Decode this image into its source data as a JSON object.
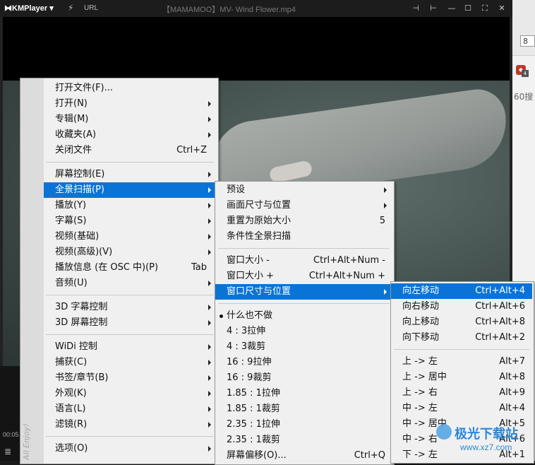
{
  "window": {
    "logo": "⧓KMPlayer ▾",
    "url_label": "URL",
    "title": "【MAMAMOO】MV- Wind Flower.mp4",
    "time": "00:05",
    "side_text": "All Enjoy!"
  },
  "bg_app": {
    "box_text": "8",
    "badge": "4",
    "text": "60搜"
  },
  "menu_main": [
    {
      "label": "打开文件(F)...",
      "shortcut": "",
      "arrow": false
    },
    {
      "label": "打开(N)",
      "shortcut": "",
      "arrow": true
    },
    {
      "label": "专辑(M)",
      "shortcut": "",
      "arrow": true
    },
    {
      "label": "收藏夹(A)",
      "shortcut": "",
      "arrow": true
    },
    {
      "label": "关闭文件",
      "shortcut": "Ctrl+Z",
      "arrow": false
    },
    {
      "label": "屏幕控制(E)",
      "shortcut": "",
      "arrow": true
    },
    {
      "label": "全景扫描(P)",
      "shortcut": "",
      "arrow": true,
      "highlight": true
    },
    {
      "label": "播放(Y)",
      "shortcut": "",
      "arrow": true
    },
    {
      "label": "字幕(S)",
      "shortcut": "",
      "arrow": true
    },
    {
      "label": "视频(基础)",
      "shortcut": "",
      "arrow": true
    },
    {
      "label": "视频(高级)(V)",
      "shortcut": "",
      "arrow": true
    },
    {
      "label": "播放信息 (在 OSC 中)(P)",
      "shortcut": "Tab",
      "arrow": false
    },
    {
      "label": "音频(U)",
      "shortcut": "",
      "arrow": true
    },
    {
      "label": "3D 字幕控制",
      "shortcut": "",
      "arrow": true
    },
    {
      "label": "3D 屏幕控制",
      "shortcut": "",
      "arrow": true
    },
    {
      "label": "WiDi 控制",
      "shortcut": "",
      "arrow": true
    },
    {
      "label": "捕获(C)",
      "shortcut": "",
      "arrow": true
    },
    {
      "label": "书签/章节(B)",
      "shortcut": "",
      "arrow": true
    },
    {
      "label": "外观(K)",
      "shortcut": "",
      "arrow": true
    },
    {
      "label": "语言(L)",
      "shortcut": "",
      "arrow": true
    },
    {
      "label": "滤镜(R)",
      "shortcut": "",
      "arrow": true
    },
    {
      "label": "选项(O)",
      "shortcut": "",
      "arrow": true
    }
  ],
  "menu_pan": [
    {
      "label": "预设",
      "shortcut": "",
      "arrow": true
    },
    {
      "label": "画面尺寸与位置",
      "shortcut": "",
      "arrow": true
    },
    {
      "label": "重置为原始大小",
      "shortcut": "5",
      "arrow": false
    },
    {
      "label": "条件性全景扫描",
      "shortcut": "",
      "arrow": false
    },
    {
      "label": "窗口大小 -",
      "shortcut": "Ctrl+Alt+Num -",
      "arrow": false
    },
    {
      "label": "窗口大小 +",
      "shortcut": "Ctrl+Alt+Num +",
      "arrow": false
    },
    {
      "label": "窗口尺寸与位置",
      "shortcut": "",
      "arrow": true,
      "highlight": true
    },
    {
      "label": "什么也不做",
      "shortcut": "",
      "arrow": false,
      "bullet": true
    },
    {
      "label": "4 : 3拉伸",
      "shortcut": "",
      "arrow": false
    },
    {
      "label": "4 : 3裁剪",
      "shortcut": "",
      "arrow": false
    },
    {
      "label": "16 : 9拉伸",
      "shortcut": "",
      "arrow": false
    },
    {
      "label": "16 : 9裁剪",
      "shortcut": "",
      "arrow": false
    },
    {
      "label": "1.85 : 1拉伸",
      "shortcut": "",
      "arrow": false
    },
    {
      "label": "1.85 : 1裁剪",
      "shortcut": "",
      "arrow": false
    },
    {
      "label": "2.35 : 1拉伸",
      "shortcut": "",
      "arrow": false
    },
    {
      "label": "2.35 : 1裁剪",
      "shortcut": "",
      "arrow": false
    },
    {
      "label": "屏幕偏移(O)...",
      "shortcut": "Ctrl+Q",
      "arrow": false
    }
  ],
  "menu_window": [
    {
      "label": "向左移动",
      "shortcut": "Ctrl+Alt+4",
      "highlight": true
    },
    {
      "label": "向右移动",
      "shortcut": "Ctrl+Alt+6"
    },
    {
      "label": "向上移动",
      "shortcut": "Ctrl+Alt+8"
    },
    {
      "label": "向下移动",
      "shortcut": "Ctrl+Alt+2"
    },
    {
      "label": "上 -> 左",
      "shortcut": "Alt+7"
    },
    {
      "label": "上 -> 居中",
      "shortcut": "Alt+8"
    },
    {
      "label": "上 -> 右",
      "shortcut": "Alt+9"
    },
    {
      "label": "中 -> 左",
      "shortcut": "Alt+4"
    },
    {
      "label": "中 -> 居中",
      "shortcut": "Alt+5"
    },
    {
      "label": "中 -> 右",
      "shortcut": "Alt+6"
    },
    {
      "label": "下 -> 左",
      "shortcut": "Alt+1"
    }
  ],
  "watermark": {
    "name": "极光下载站",
    "url": "www.xz7.com"
  }
}
